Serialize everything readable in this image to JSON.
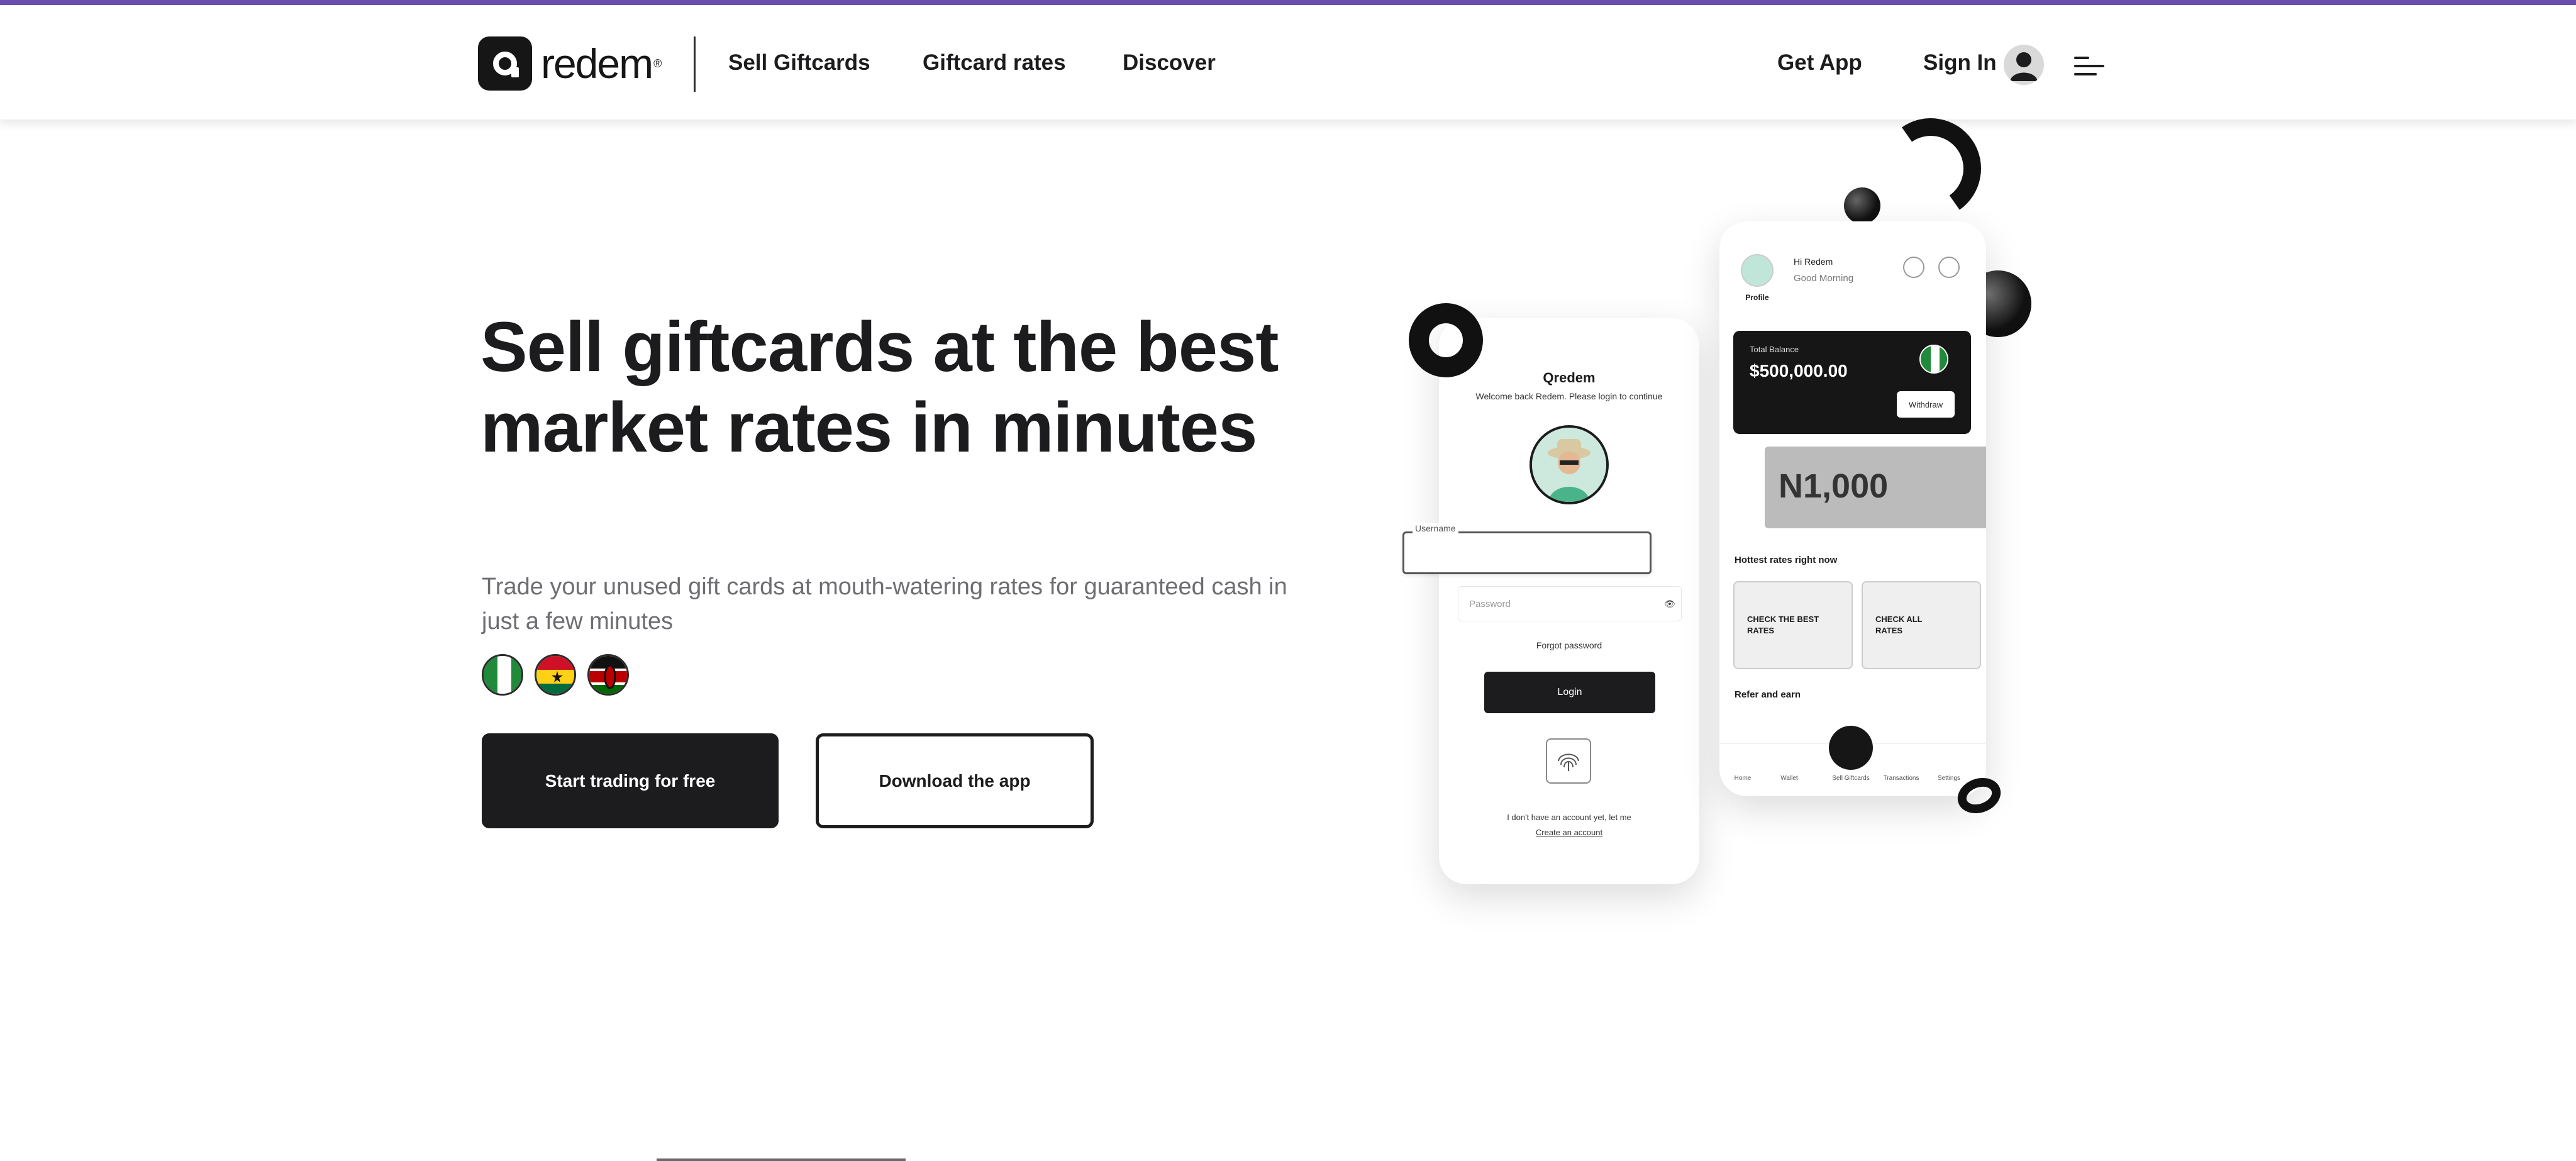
{
  "brand": {
    "name": "redem",
    "tm": "®"
  },
  "nav": {
    "sell_giftcards": "Sell Giftcards",
    "giftcard_rates": "Giftcard rates",
    "discover": "Discover",
    "get_app": "Get App",
    "sign_in": "Sign In"
  },
  "hero": {
    "title": "Sell giftcards at the best market rates in minutes",
    "subtitle": "Trade your unused gift cards at mouth-watering rates for guaranteed cash in just a few minutes",
    "flags": [
      "nigeria-flag-icon",
      "ghana-flag-icon",
      "kenya-flag-icon"
    ],
    "primary_cta": "Start trading for free",
    "secondary_cta": "Download the app"
  },
  "login_phone": {
    "logo": "Qredem",
    "welcome": "Welcome back Redem. Please login to continue",
    "username_label": "Username",
    "password_placeholder": "Password",
    "forgot": "Forgot password",
    "login_button": "Login",
    "no_account": "I don't have an account yet, let me",
    "create_account": "Create an account"
  },
  "home_phone": {
    "profile": "Profile",
    "greeting": "Hi Redem",
    "good_morning": "Good Morning",
    "total_balance_label": "Total Balance",
    "balance": "$500,000.00",
    "withdraw": "Withdraw",
    "referral_amount": "N1,000",
    "hottest_rates": "Hottest rates right now",
    "card1": "CHECK THE BEST RATES",
    "card2": "CHECK ALL RATES",
    "refer_earn": "Refer and earn",
    "tabs": [
      "Home",
      "Wallet",
      "Sell Giftcards",
      "Transactions",
      "Settings"
    ]
  },
  "colors": {
    "accent": "#6b4fb0",
    "dark": "#1c1c1e",
    "muted": "#6d6d72"
  }
}
